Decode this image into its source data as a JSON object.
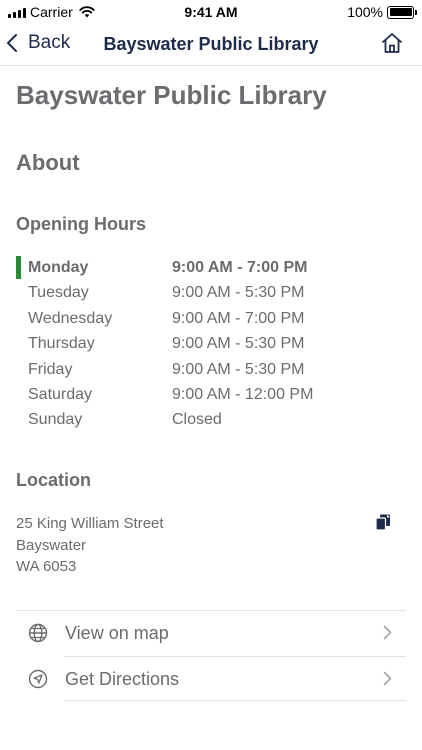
{
  "status_bar": {
    "carrier": "Carrier",
    "time": "9:41 AM",
    "battery": "100%"
  },
  "nav": {
    "back_label": "Back",
    "title": "Bayswater Public Library"
  },
  "page": {
    "title": "Bayswater Public Library",
    "section": "About"
  },
  "hours": {
    "heading": "Opening Hours",
    "rows": [
      {
        "day": "Monday",
        "time": "9:00 AM - 7:00 PM",
        "today": true
      },
      {
        "day": "Tuesday",
        "time": "9:00 AM - 5:30 PM",
        "today": false
      },
      {
        "day": "Wednesday",
        "time": "9:00 AM - 7:00 PM",
        "today": false
      },
      {
        "day": "Thursday",
        "time": "9:00 AM - 5:30 PM",
        "today": false
      },
      {
        "day": "Friday",
        "time": "9:00 AM - 5:30 PM",
        "today": false
      },
      {
        "day": "Saturday",
        "time": "9:00 AM - 12:00 PM",
        "today": false
      },
      {
        "day": "Sunday",
        "time": "Closed",
        "today": false
      }
    ]
  },
  "location": {
    "heading": "Location",
    "address_line1": "25 King William Street",
    "address_line2": "Bayswater",
    "address_line3": "WA 6053"
  },
  "actions": [
    {
      "label": "View on map",
      "icon": "globe-icon"
    },
    {
      "label": "Get Directions",
      "icon": "navigation-arrow-icon"
    }
  ],
  "colors": {
    "accent": "#1f2b4a",
    "today_marker": "#2a8a33",
    "text": "#6b6b70"
  }
}
